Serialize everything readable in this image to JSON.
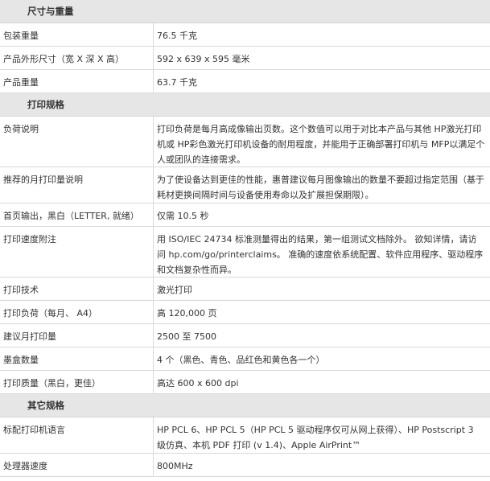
{
  "sections": [
    {
      "title": "尺寸与重量",
      "rows": [
        {
          "label": "包装重量",
          "value": "76.5 千克"
        },
        {
          "label": "产品外形尺寸（宽 X 深 X 高）",
          "value": "592 x 639 x 595 毫米"
        },
        {
          "label": "产品重量",
          "value": "63.7 千克"
        }
      ]
    },
    {
      "title": "打印规格",
      "rows": [
        {
          "label": "负荷说明",
          "value": "打印负荷是每月高成像输出页数。这个数值可以用于对比本产品与其他 HP激光打印机或 HP彩色激光打印机设备的耐用程度，并能用于正确部署打印机与 MFP以满足个人或团队的连接需求。"
        },
        {
          "label": "推荐的月打印量说明",
          "value": "为了使设备达到更佳的性能，惠普建议每月图像输出的数量不要超过指定范围（基于耗材更换间隔时间与设备使用寿命以及扩展担保期限）。"
        },
        {
          "label": "首页输出，黑白（LETTER, 就绪）",
          "value": "仅需 10.5 秒"
        },
        {
          "label": "打印速度附注",
          "value": "用 ISO/IEC 24734 标准测量得出的结果，第一组测试文档除外。 欲知详情，请访问 hp.com/go/printerclaims。 准确的速度依系统配置、软件应用程序、驱动程序和文档复杂性而异。"
        },
        {
          "label": "打印技术",
          "value": "激光打印"
        },
        {
          "label": "打印负荷（每月、 A4）",
          "value": "高 120,000 页"
        },
        {
          "label": "建议月打印量",
          "value": "2500 至 7500"
        },
        {
          "label": "墨盒数量",
          "value": "4 个（黑色、青色、品红色和黄色各一个）"
        },
        {
          "label": "打印质量（黑白，更佳）",
          "value": "高达 600 x 600 dpi"
        }
      ]
    },
    {
      "title": "其它规格",
      "rows": [
        {
          "label": "标配打印机语言",
          "value": "HP PCL 6、HP PCL 5（HP PCL 5 驱动程序仅可从网上获得）、HP Postscript 3 级仿真、本机 PDF 打印 (v 1.4)、Apple AirPrint™"
        },
        {
          "label": "处理器速度",
          "value": "800MHz"
        }
      ]
    }
  ]
}
